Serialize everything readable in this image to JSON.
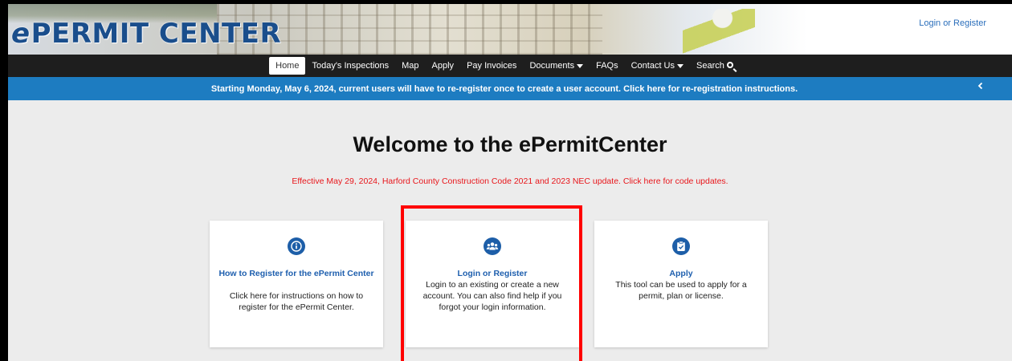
{
  "header": {
    "logo_e": "e",
    "logo_text": "PERMIT CENTER",
    "login_link": "Login or Register"
  },
  "nav": {
    "items": [
      {
        "label": "Home",
        "active": true
      },
      {
        "label": "Today's Inspections"
      },
      {
        "label": "Map"
      },
      {
        "label": "Apply"
      },
      {
        "label": "Pay Invoices"
      },
      {
        "label": "Documents",
        "dropdown": true
      },
      {
        "label": "FAQs"
      },
      {
        "label": "Contact Us",
        "dropdown": true
      },
      {
        "label": "Search",
        "icon": "search-icon"
      }
    ]
  },
  "announcement": {
    "text": "Starting Monday, May 6, 2024, current users will have to re-register once to create a user account.  Click here for re-registration instructions.",
    "icon": "chevron-left-icon"
  },
  "main": {
    "welcome": "Welcome to the ePermitCenter",
    "notice": "Effective May 29, 2024,  Harford County Construction Code 2021 and 2023 NEC update. Click here for code updates."
  },
  "cards": [
    {
      "icon": "info-icon",
      "title": "How to Register for the ePermit Center",
      "desc": "Click here for instructions on how to register for the ePermit Center."
    },
    {
      "icon": "users-icon",
      "title": "Login or Register",
      "desc": "Login to an existing or create a new account. You can also find help if you forgot your login information."
    },
    {
      "icon": "clipboard-check-icon",
      "title": "Apply",
      "desc": "This tool can be used to apply for a permit, plan or license."
    }
  ],
  "colors": {
    "nav_bg": "#1e1e1e",
    "announce_bg": "#1d7cc1",
    "link_blue": "#1e5fae",
    "notice_red": "#e8161b",
    "highlight": "#ff0000"
  }
}
